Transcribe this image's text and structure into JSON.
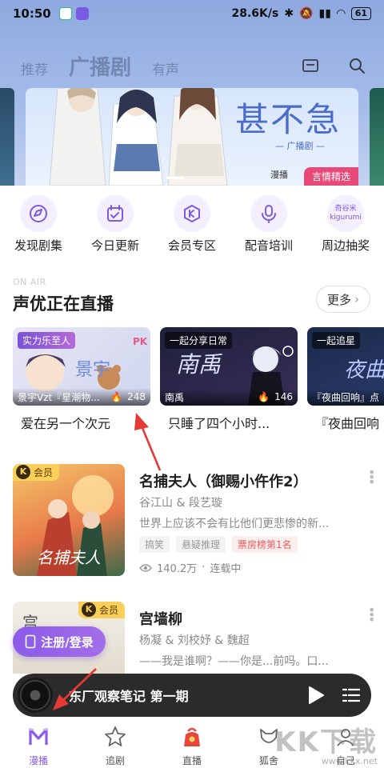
{
  "status_bar": {
    "time": "10:50",
    "network_speed": "28.6K/s",
    "battery": "61"
  },
  "header": {
    "tabs": [
      {
        "label": "推荐",
        "active": false
      },
      {
        "label": "广播剧",
        "active": true
      },
      {
        "label": "有声",
        "active": false
      }
    ],
    "icons": [
      "mail-icon",
      "search-icon"
    ]
  },
  "banner": {
    "title": "甚不急",
    "subtitle": "— 广播剧 —",
    "logo_text": "漫播",
    "badge": "言情精选"
  },
  "quick_entries": [
    {
      "label": "发现剧集",
      "icon": "discover-icon"
    },
    {
      "label": "今日更新",
      "icon": "calendar-update-icon"
    },
    {
      "label": "会员专区",
      "icon": "vip-icon"
    },
    {
      "label": "配音培训",
      "icon": "microphone-icon"
    },
    {
      "label": "周边抽奖",
      "icon": "kigurumi-icon",
      "icon_text": "奇谷米 kigurumi"
    }
  ],
  "live_section": {
    "eyebrow": "ON AIR",
    "title": "声优正在直播",
    "more": "更多",
    "cards": [
      {
        "tag": "实力乐至人",
        "host": "景宇Vzt『星潮物...",
        "heat": "248",
        "caption": "爱在另一个次元",
        "cover_text": "景宇",
        "pk": "PK"
      },
      {
        "tag": "一起分享日常",
        "host": "南禹",
        "heat": "146",
        "caption": "只睡了四个小时...",
        "cover_text": "南禹"
      },
      {
        "tag": "一起追星",
        "host": "『夜曲回响』点",
        "heat": "",
        "caption": "『夜曲回响",
        "cover_text": "夜曲"
      }
    ]
  },
  "dramas": [
    {
      "title": "名捕夫人（御赐小仵作2）",
      "cast": "谷江山 & 段艺璇",
      "desc": "世界上应该不会有比他们更悲惨的新...",
      "tags": [
        "搞笑",
        "悬疑推理",
        "票房榜第1名"
      ],
      "plays": "140.2万",
      "status": "连载中",
      "badge": "会员",
      "cover_text": "名捕夫人"
    },
    {
      "title": "宫墙柳",
      "cast": "杨凝 & 刘校妤 & 魏超",
      "desc": "——我是谁啊？——你是...前吗。口...",
      "badge": "会员",
      "cover_text": "宫"
    }
  ],
  "login_button": "注册/登录",
  "player": {
    "title": "东厂观察笔记 第一期"
  },
  "bottom_nav": [
    {
      "label": "漫播",
      "active": true
    },
    {
      "label": "追剧",
      "active": false
    },
    {
      "label": "直播",
      "active": false
    },
    {
      "label": "狐舍",
      "active": false
    },
    {
      "label": "自己",
      "active": false
    }
  ],
  "watermark": {
    "brand": "KK下载",
    "url": "www.kkx.net"
  },
  "colors": {
    "accent": "#8a5be6",
    "header_bg": "#a5bde9",
    "banner_badge": "#e84a77",
    "vip_badge": "#fbd05a",
    "hot_tag": "#f05a5a",
    "annotation_arrow": "#e53935"
  }
}
